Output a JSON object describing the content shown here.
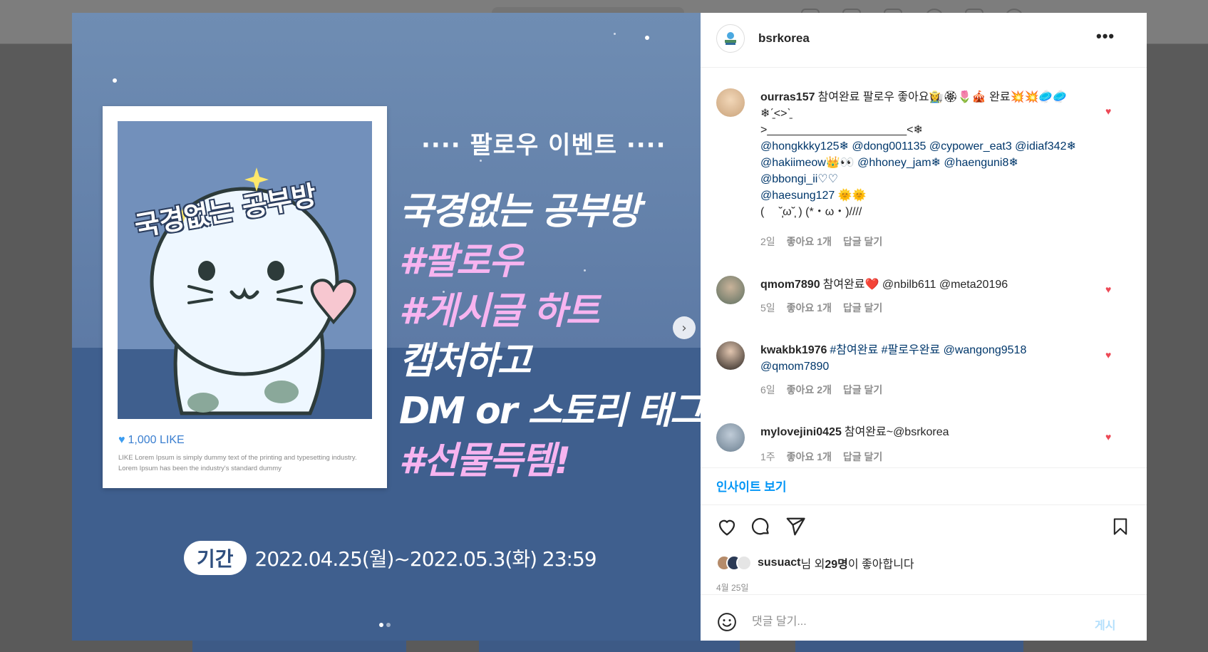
{
  "post": {
    "account": "bsrkorea",
    "more_label": "•••"
  },
  "media": {
    "polaroid": {
      "title": "국경없는 공부방",
      "like_label": "1,000 LIKE",
      "lorem": "LIKE Lorem Ipsum is simply dummy text of the printing and typesetting industry. Lorem Ipsum has been the industry's standard dummy"
    },
    "heading": "···· 팔로우 이벤트 ····",
    "lines": [
      "국경없는 공부방",
      "#팔로우",
      "#게시글 하트",
      "캡처하고",
      "DM or 스토리 태그",
      "#선물득템!"
    ],
    "period_badge": "기간",
    "period_text": "2022.04.25(월)~2022.05.3(화) 23:59",
    "next_label": "›"
  },
  "comments": [
    {
      "user": "ourras157",
      "lines": [
        "참여완료 팔로우 좋아요👩‍🌾🏵🌷🎪 완료💥💥🥏🥏",
        "❄︎ˊ̱˂˃ˋ̱",
        ">______________________<❄︎",
        "@hongkkky125❄︎ @dong001135 @cypower_eat3 @idiaf342❄︎",
        "@hakiimeow👑👀 @hhoney_jam❄︎ @haenguni8❄︎",
        "@bbongi_ii♡♡",
        "@haesung127 🌞🌞",
        "(　 ˘̩̩̩ω˘̩̩̩ ) (*・ω・)////"
      ],
      "time": "2일",
      "likes": "좋아요 1개",
      "reply": "답글 달기"
    },
    {
      "user": "qmom7890",
      "lines": [
        "참여완료❤️ @nbilb611 @meta20196"
      ],
      "time": "5일",
      "likes": "좋아요 1개",
      "reply": "답글 달기"
    },
    {
      "user": "kwakbk1976",
      "lines": [
        "#참여완료 #팔로우완료 @wangong9518",
        "@qmom7890"
      ],
      "time": "6일",
      "likes": "좋아요 2개",
      "reply": "답글 달기"
    },
    {
      "user": "mylovejini0425",
      "lines": [
        "참여완료~@bsrkorea"
      ],
      "time": "1주",
      "likes": "좋아요 1개",
      "reply": "답글 달기"
    }
  ],
  "insights_label": "인사이트 보기",
  "likes": {
    "user": "susuact",
    "middle": "님 외 ",
    "count": "29명",
    "suffix": "이 좋아합니다"
  },
  "date": "4월 25일",
  "composer": {
    "placeholder": "댓글 달기...",
    "post_label": "게시"
  },
  "colors": {
    "accent": "#0095f6",
    "heart": "#ed4956",
    "promo_pink": "#f7b4f0",
    "media_bg": "#3f5f8e"
  },
  "icons": [
    "heart-icon",
    "comment-icon",
    "share-icon",
    "bookmark-icon",
    "emoji-icon",
    "chevron-right-icon"
  ]
}
